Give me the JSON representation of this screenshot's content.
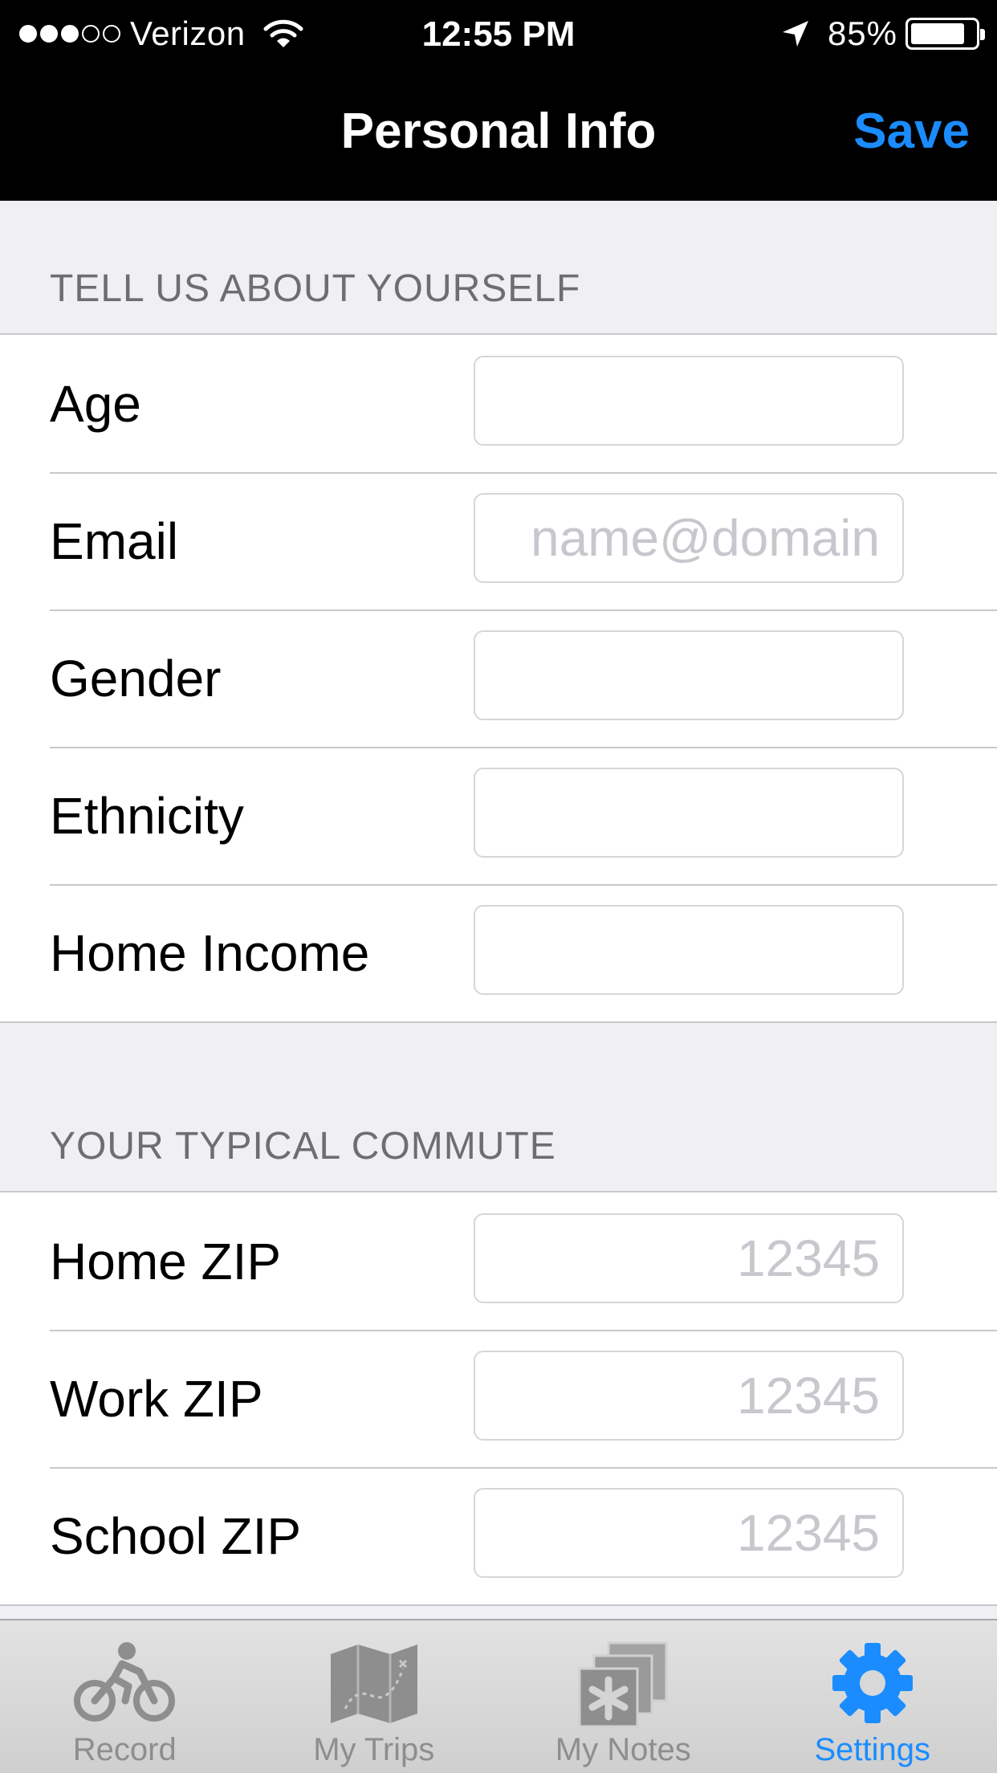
{
  "status_bar": {
    "carrier": "Verizon",
    "signal_bars_filled": 3,
    "signal_bars_total": 5,
    "time": "12:55 PM",
    "battery_percent": "85%",
    "battery_level": 0.85
  },
  "nav": {
    "title": "Personal Info",
    "save_label": "Save",
    "accent_color": "#1a8cff"
  },
  "sections": [
    {
      "header": "TELL US ABOUT YOURSELF",
      "rows": [
        {
          "label": "Age",
          "value": "",
          "placeholder": ""
        },
        {
          "label": "Email",
          "value": "",
          "placeholder": "name@domain"
        },
        {
          "label": "Gender",
          "value": "",
          "placeholder": ""
        },
        {
          "label": "Ethnicity",
          "value": "",
          "placeholder": ""
        },
        {
          "label": "Home Income",
          "value": "",
          "placeholder": ""
        }
      ]
    },
    {
      "header": "YOUR TYPICAL COMMUTE",
      "rows": [
        {
          "label": "Home ZIP",
          "value": "",
          "placeholder": "12345"
        },
        {
          "label": "Work ZIP",
          "value": "",
          "placeholder": "12345"
        },
        {
          "label": "School ZIP",
          "value": "",
          "placeholder": "12345"
        }
      ]
    }
  ],
  "tab_bar": {
    "tabs": [
      {
        "label": "Record",
        "icon": "bicycle-icon",
        "active": false
      },
      {
        "label": "My Trips",
        "icon": "map-icon",
        "active": false
      },
      {
        "label": "My Notes",
        "icon": "notes-icon",
        "active": false
      },
      {
        "label": "Settings",
        "icon": "gear-icon",
        "active": true
      }
    ]
  }
}
